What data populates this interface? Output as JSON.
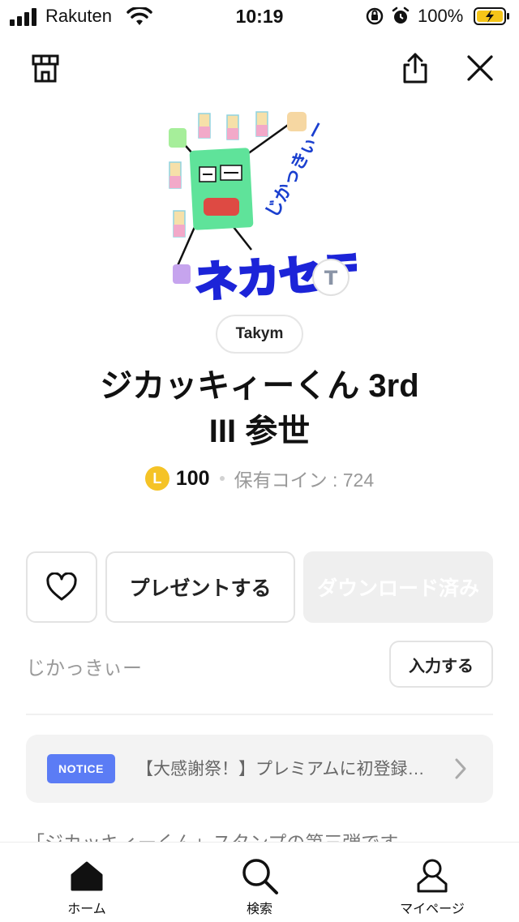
{
  "status_bar": {
    "carrier": "Rakuten",
    "time": "10:19",
    "battery": "100%"
  },
  "header": {
    "shop_icon": "shop-icon",
    "share_icon": "share-icon",
    "close_icon": "close-icon"
  },
  "sticker": {
    "image": "sticker-illustration",
    "text_vertical": "じかっきぃー",
    "text_main": "ネカセテ",
    "badge_letter": "T"
  },
  "product": {
    "author": "Takym",
    "title_line1": "ジカッキィーくん 3rd",
    "title_line2": "III 参世",
    "coin_letter": "L",
    "price": "100",
    "owned_coins": "保有コイン : 724"
  },
  "actions": {
    "like_icon": "heart-icon",
    "present_label": "プレゼントする",
    "downloaded_label": "ダウンロード済み"
  },
  "custom_input": {
    "label": "じかっきぃー",
    "button_label": "入力する"
  },
  "notice": {
    "badge": "NOTICE",
    "text": "【大感謝祭！】プレミアムに初登録…"
  },
  "description": "「ジカッキィーくん」スタンプの第三弾です。",
  "tabbar": {
    "tabs": [
      {
        "label": "ホーム",
        "icon": "home-icon"
      },
      {
        "label": "検索",
        "icon": "search-icon"
      },
      {
        "label": "マイページ",
        "icon": "person-icon"
      }
    ]
  },
  "colors": {
    "accent_notice": "#5b7cf5",
    "coin": "#f5c326"
  }
}
